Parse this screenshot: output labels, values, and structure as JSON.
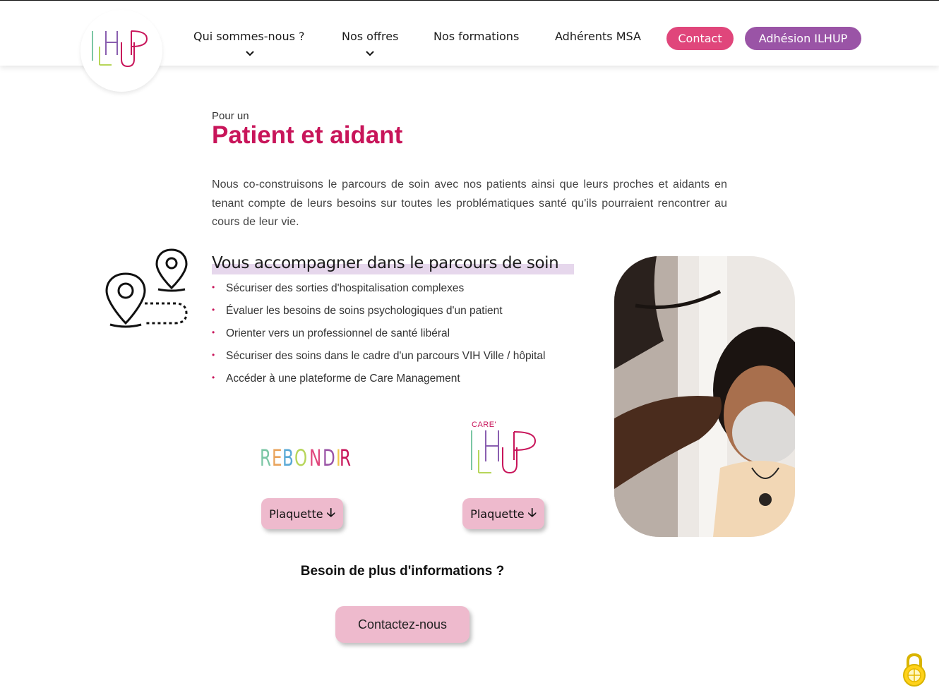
{
  "nav": {
    "items": [
      {
        "label": "Qui sommes-nous ?",
        "has_dropdown": true
      },
      {
        "label": "Nos offres",
        "has_dropdown": true
      },
      {
        "label": "Nos formations",
        "has_dropdown": false
      },
      {
        "label": "Adhérents MSA",
        "has_dropdown": false
      }
    ],
    "contact_label": "Contact",
    "adhesion_label": "Adhésion ILHUP",
    "contact_color": "#e0467b",
    "adhesion_color": "#9a54a6"
  },
  "logo": {
    "text": "ILHUP",
    "icon": "ilhup-logo"
  },
  "intro": {
    "small": "Pour un",
    "title": "Patient et aidant",
    "paragraph": "Nous co-construisons le parcours de soin avec nos patients ainsi que leurs proches et aidants en tenant compte de leurs besoins sur toutes les problématiques santé qu'ils pourraient rencontrer au cours de leur vie."
  },
  "section": {
    "icon": "map-pins-route-icon",
    "title": "Vous accompagner dans le parcours de soin",
    "bullets": [
      "Sécuriser des sorties d'hospitalisation complexes",
      "Évaluer les besoins de soins psychologiques d'un patient",
      "Orienter vers un professionnel de santé libéral",
      "Sécuriser des soins dans le cadre d'un parcours VIH Ville / hôpital",
      "Accéder à une plateforme de Care Management"
    ]
  },
  "partners": [
    {
      "name": "REBONDIR",
      "button": "Plaquette",
      "icon": "arrow-down-icon"
    },
    {
      "name": "CARE' ILHUP",
      "care_text": "CARE'",
      "button": "Plaquette",
      "icon": "arrow-down-icon"
    }
  ],
  "photo": {
    "icon": "child-with-mask-photo"
  },
  "cta": {
    "question": "Besoin de plus d'informations ?",
    "button": "Contactez-nous"
  },
  "colors": {
    "accent": "#c8155a",
    "button_pink": "#eebacd"
  }
}
